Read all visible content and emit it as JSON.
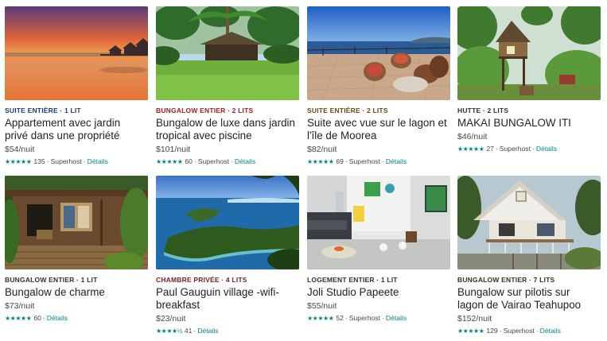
{
  "colors": {
    "accent": "#008489",
    "tag_blue": "#1b3a80",
    "tag_red": "#a61d1d",
    "tag_brown": "#6e4414",
    "tag_dark": "#3b2f24",
    "tag_maroon": "#7a1f1f"
  },
  "listings": [
    {
      "type": "SUITE ENTIÈRE · 1 LIT",
      "title_l1": "Appartement avec jardin",
      "title_l2": "privé dans une propriété",
      "price": "$54/nuit",
      "rating_icon": "star-icon",
      "stars": "★★★★★",
      "reviews": "135",
      "superhost": "Superhost",
      "details": "Détails"
    },
    {
      "type": "BUNGALOW ENTIER · 2 LITS",
      "title_l1": "Bungalow de luxe dans jardin",
      "title_l2": "tropical avec piscine",
      "price": "$101/nuit",
      "stars": "★★★★★",
      "reviews": "60",
      "superhost": "Superhost",
      "details": "Détails"
    },
    {
      "type": "SUITE ENTIÈRE · 2 LITS",
      "title_l1": "Suite avec vue sur le lagon et",
      "title_l2": "l'île de Moorea",
      "price": "$82/nuit",
      "stars": "★★★★★",
      "reviews": "69",
      "superhost": "Superhost",
      "details": "Détails"
    },
    {
      "type": "HUTTE · 2 LITS",
      "title_l1": "MAKAI BUNGALOW ITI",
      "title_l2": "",
      "price": "$46/nuit",
      "stars": "★★★★★",
      "reviews": "27",
      "superhost": "Superhost",
      "details": "Détails"
    },
    {
      "type": "BUNGALOW ENTIER · 1 LIT",
      "title_l1": "Bungalow de charme",
      "title_l2": "",
      "price": "$73/nuit",
      "stars": "★★★★★",
      "reviews": "60",
      "superhost": "",
      "details": "Détails"
    },
    {
      "type": "CHAMBRE PRIVÉE · 4 LITS",
      "title_l1": "Paul Gauguin village -wifi-",
      "title_l2": "breakfast",
      "price": "$23/nuit",
      "stars": "★★★★½",
      "reviews": "41",
      "superhost": "",
      "details": "Détails"
    },
    {
      "type": "LOGEMENT ENTIER · 1 LIT",
      "title_l1": "Joli Studio Papeete",
      "title_l2": "",
      "price": "$55/nuit",
      "stars": "★★★★★",
      "reviews": "52",
      "superhost": "Superhost",
      "details": "Détails"
    },
    {
      "type": "BUNGALOW ENTIER · 7 LITS",
      "title_l1": "Bungalow sur pilotis sur",
      "title_l2": "lagon de Vairao Teahupoo",
      "price": "$152/nuit",
      "stars": "★★★★★",
      "reviews": "129",
      "superhost": "Superhost",
      "details": "Détails"
    }
  ]
}
